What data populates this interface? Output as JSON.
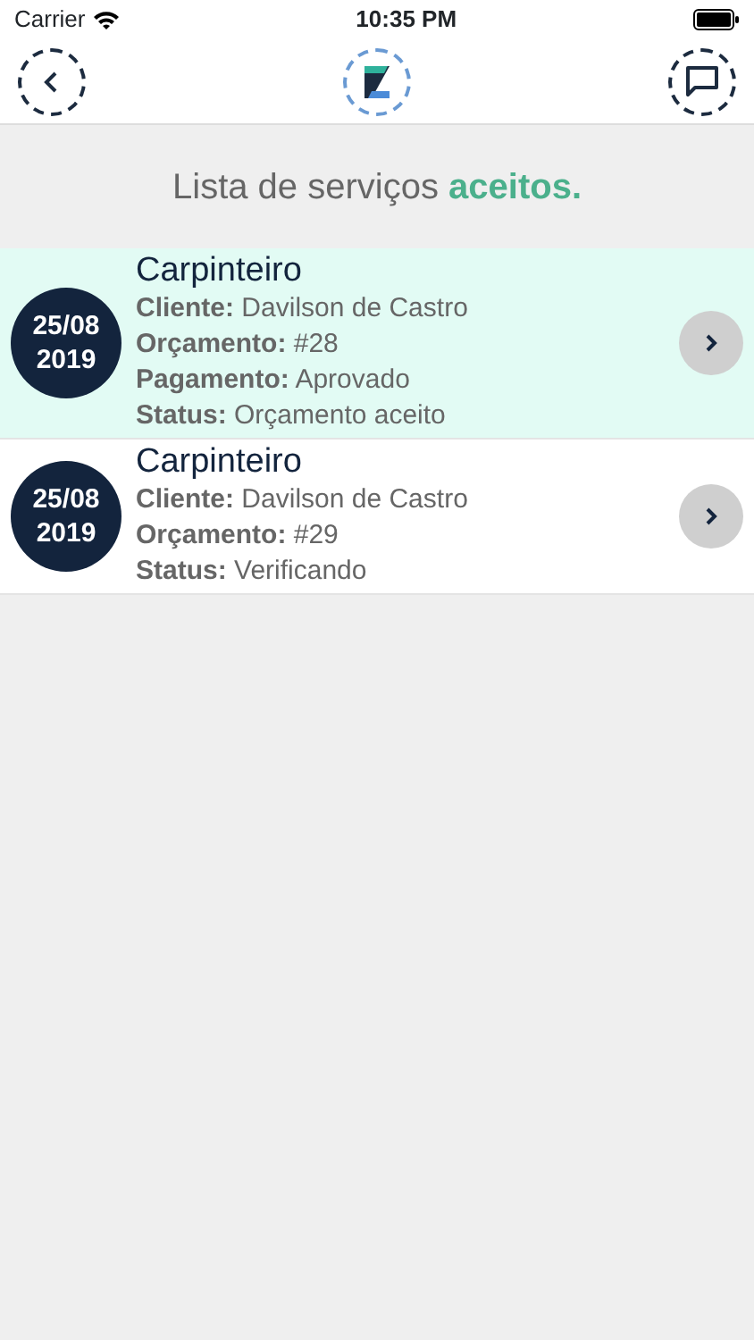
{
  "status_bar": {
    "carrier": "Carrier",
    "time": "10:35 PM"
  },
  "heading": "Lista de serviços **aceitos.**",
  "services": [
    {
      "selected": true,
      "date": "25/08",
      "year": "2019",
      "title": "Carpinteiro",
      "details": [
        {
          "label": "Cliente:",
          "value": "Davilson de Castro"
        },
        {
          "label": "Orçamento:",
          "value": "#28"
        },
        {
          "label": "Pagamento:",
          "value": "Aprovado"
        },
        {
          "label": "Status:",
          "value": "Orçamento aceito"
        }
      ]
    },
    {
      "selected": false,
      "date": "25/08",
      "year": "2019",
      "title": "Carpinteiro",
      "details": [
        {
          "label": "Cliente:",
          "value": "Davilson de Castro"
        },
        {
          "label": "Orçamento:",
          "value": "#29"
        },
        {
          "label": "Status:",
          "value": "Verificando"
        }
      ]
    }
  ]
}
